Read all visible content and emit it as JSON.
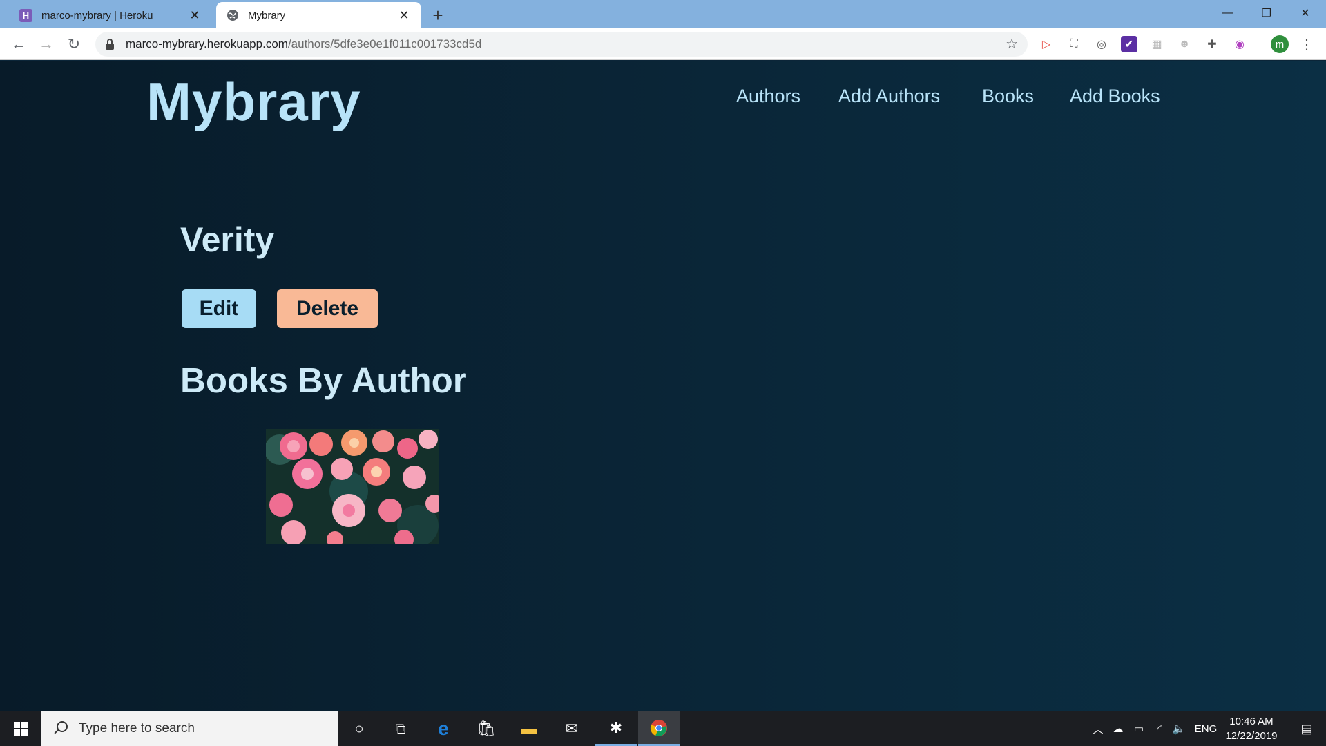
{
  "browser": {
    "tabs": [
      {
        "title": "marco-mybrary | Heroku",
        "favicon": "heroku-icon"
      },
      {
        "title": "Mybrary",
        "favicon": "globe-icon"
      }
    ],
    "url_host": "marco-mybrary.herokuapp.com",
    "url_path": "/authors/5dfe3e0e1f011c001733cd5d",
    "profile_initial": "m"
  },
  "site": {
    "brand": "Mybrary",
    "nav": [
      "Authors",
      "Add Authors",
      "Books",
      "Add Books"
    ]
  },
  "author": {
    "name": "Verity",
    "edit_label": "Edit",
    "delete_label": "Delete",
    "books_heading": "Books By Author"
  },
  "taskbar": {
    "search_placeholder": "Type here to search",
    "language": "ENG",
    "time": "10:46 AM",
    "date": "12/22/2019"
  },
  "colors": {
    "brand": "#b8e3f8",
    "edit_button": "#a7dcf5",
    "delete_button": "#f9b996",
    "tabstrip": "#84b1de"
  }
}
